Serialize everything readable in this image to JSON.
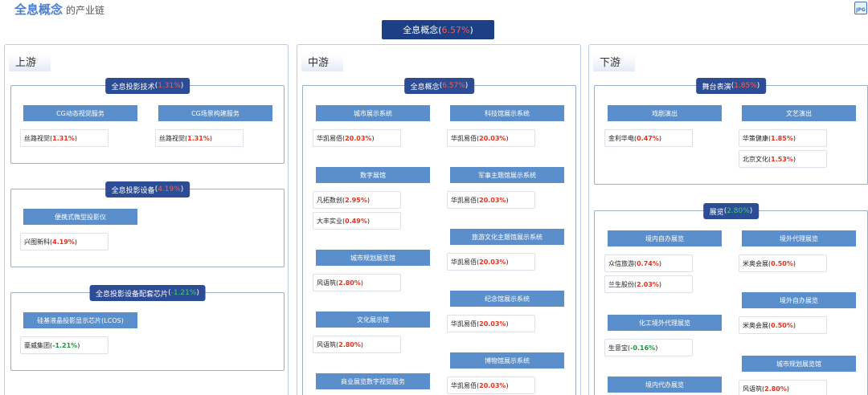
{
  "header": {
    "title": "全息概念",
    "subtitle": "的产业链",
    "export_icon": "jpg-export-icon",
    "export_label": "JPG"
  },
  "top": {
    "name": "全息概念",
    "open": "(",
    "change": "6.57%",
    "close": ")"
  },
  "colors": {
    "up": "#e8301c",
    "down": "#169a3a",
    "badge": "#1c3f86",
    "box_title": "#2c4d96",
    "button": "#5b8fcb"
  },
  "columns": {
    "upstream": {
      "label": "上游",
      "boxes": [
        {
          "name": "全息投影技术",
          "open": "(",
          "change": "1.31%",
          "close": ")",
          "items": [
            {
              "label": "CG动态视觉服务",
              "stocks": [
                {
                  "name": "丝路视觉",
                  "open": " (",
                  "change": "1.31%",
                  "close": ")"
                }
              ]
            },
            {
              "label": "CG场景构建服务",
              "stocks": [
                {
                  "name": "丝路视觉",
                  "open": " (",
                  "change": "1.31%",
                  "close": ")"
                }
              ]
            }
          ]
        },
        {
          "name": "全息投影设备",
          "open": "(",
          "change": "4.19%",
          "close": ")",
          "items": [
            {
              "label": "便携式微型投影仪",
              "stocks": [
                {
                  "name": "兴图新科",
                  "open": " (",
                  "change": "4.19%",
                  "close": ")"
                }
              ]
            }
          ]
        },
        {
          "name": "全息投影设备配套芯片",
          "open": "(",
          "change": "-1.21%",
          "close": ")",
          "items": [
            {
              "label": "硅基液晶投影显示芯片(LCOS)",
              "stocks": [
                {
                  "name": "豪威集团",
                  "open": " (",
                  "change": "-1.21%",
                  "close": ")"
                }
              ]
            }
          ]
        }
      ]
    },
    "midstream": {
      "label": "中游",
      "boxes": [
        {
          "name": "全息概念",
          "open": "(",
          "change": "6.57%",
          "close": ")",
          "items": [
            {
              "label": "城市展示系统",
              "stocks": [
                {
                  "name": "华凯易佰",
                  "open": " (",
                  "change": "20.03%",
                  "close": ")"
                }
              ]
            },
            {
              "label": "科技馆展示系统",
              "stocks": [
                {
                  "name": "华凯易佰",
                  "open": " (",
                  "change": "20.03%",
                  "close": ")"
                }
              ]
            },
            {
              "label": "数字展馆",
              "stocks": [
                {
                  "name": "凡拓数创",
                  "open": " (",
                  "change": "2.95%",
                  "close": ")"
                },
                {
                  "name": "大丰实业",
                  "open": " (",
                  "change": "0.49%",
                  "close": ")"
                }
              ]
            },
            {
              "label": "军事主题馆展示系统",
              "stocks": [
                {
                  "name": "华凯易佰",
                  "open": " (",
                  "change": "20.03%",
                  "close": ")"
                }
              ]
            },
            {
              "label": "旅游文化主题馆展示系统",
              "stocks": [
                {
                  "name": "华凯易佰",
                  "open": " (",
                  "change": "20.03%",
                  "close": ")"
                }
              ]
            },
            {
              "label": "城市规划展览馆",
              "stocks": [
                {
                  "name": "风语筑",
                  "open": " (",
                  "change": "2.80%",
                  "close": ")"
                }
              ]
            },
            {
              "label": "纪念馆展示系统",
              "stocks": [
                {
                  "name": "华凯易佰",
                  "open": " (",
                  "change": "20.03%",
                  "close": ")"
                }
              ]
            },
            {
              "label": "文化展示馆",
              "stocks": [
                {
                  "name": "风语筑",
                  "open": " (",
                  "change": "2.80%",
                  "close": ")"
                }
              ]
            },
            {
              "label": "博物馆展示系统",
              "stocks": [
                {
                  "name": "华凯易佰",
                  "open": " (",
                  "change": "20.03%",
                  "close": ")"
                }
              ]
            },
            {
              "label": "商业展览数字视觉服务",
              "stocks": []
            }
          ]
        }
      ]
    },
    "downstream": {
      "label": "下游",
      "boxes": [
        {
          "name": "舞台表演",
          "open": "(",
          "change": "1.85%",
          "close": ")",
          "items": [
            {
              "label": "戏剧演出",
              "stocks": [
                {
                  "name": "金利华电",
                  "open": " (",
                  "change": "0.47%",
                  "close": ")"
                }
              ]
            },
            {
              "label": "文艺演出",
              "stocks": [
                {
                  "name": "华策健康",
                  "open": " (",
                  "change": "1.85%",
                  "close": ")"
                },
                {
                  "name": "北京文化",
                  "open": " (",
                  "change": "1.53%",
                  "close": ")"
                }
              ]
            }
          ]
        },
        {
          "name": "展览",
          "open": "(",
          "change": "2.80%",
          "close": ")",
          "items": [
            {
              "label": "境内自办展览",
              "stocks": [
                {
                  "name": "众信旅游",
                  "open": " (",
                  "change": "0.74%",
                  "close": ")"
                },
                {
                  "name": "兰生股份",
                  "open": " (",
                  "change": "2.03%",
                  "close": ")"
                }
              ]
            },
            {
              "label": "境外代理展览",
              "stocks": [
                {
                  "name": "米奥会展",
                  "open": " (",
                  "change": "0.50%",
                  "close": ")"
                }
              ]
            },
            {
              "label": "境外自办展览",
              "stocks": [
                {
                  "name": "米奥会展",
                  "open": " (",
                  "change": "0.50%",
                  "close": ")"
                }
              ]
            },
            {
              "label": "化工境外代理展览",
              "stocks": [
                {
                  "name": "生意宝",
                  "open": " (",
                  "change": "-0.16%",
                  "close": ")"
                }
              ]
            },
            {
              "label": "城市规划展览馆",
              "stocks": [
                {
                  "name": "风语筑",
                  "open": " (",
                  "change": "2.80%",
                  "close": ")"
                }
              ]
            },
            {
              "label": "境内代办展览",
              "stocks": []
            }
          ]
        }
      ]
    }
  }
}
